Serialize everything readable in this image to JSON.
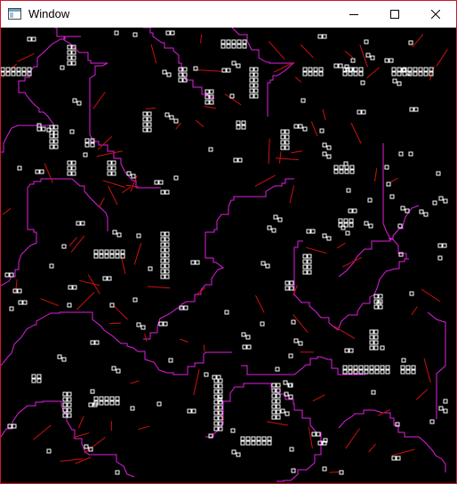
{
  "window": {
    "title": "Window",
    "controls": {
      "minimize": "minimize",
      "maximize": "maximize",
      "close": "close"
    }
  },
  "canvas": {
    "background": "#000000",
    "colors": {
      "trace": "#e020e0",
      "link": "#d01010",
      "component": "#ffffff"
    }
  },
  "icons": {
    "app": "app-window-icon",
    "minimize": "minimize-icon",
    "maximize": "maximize-icon",
    "close": "close-icon"
  }
}
